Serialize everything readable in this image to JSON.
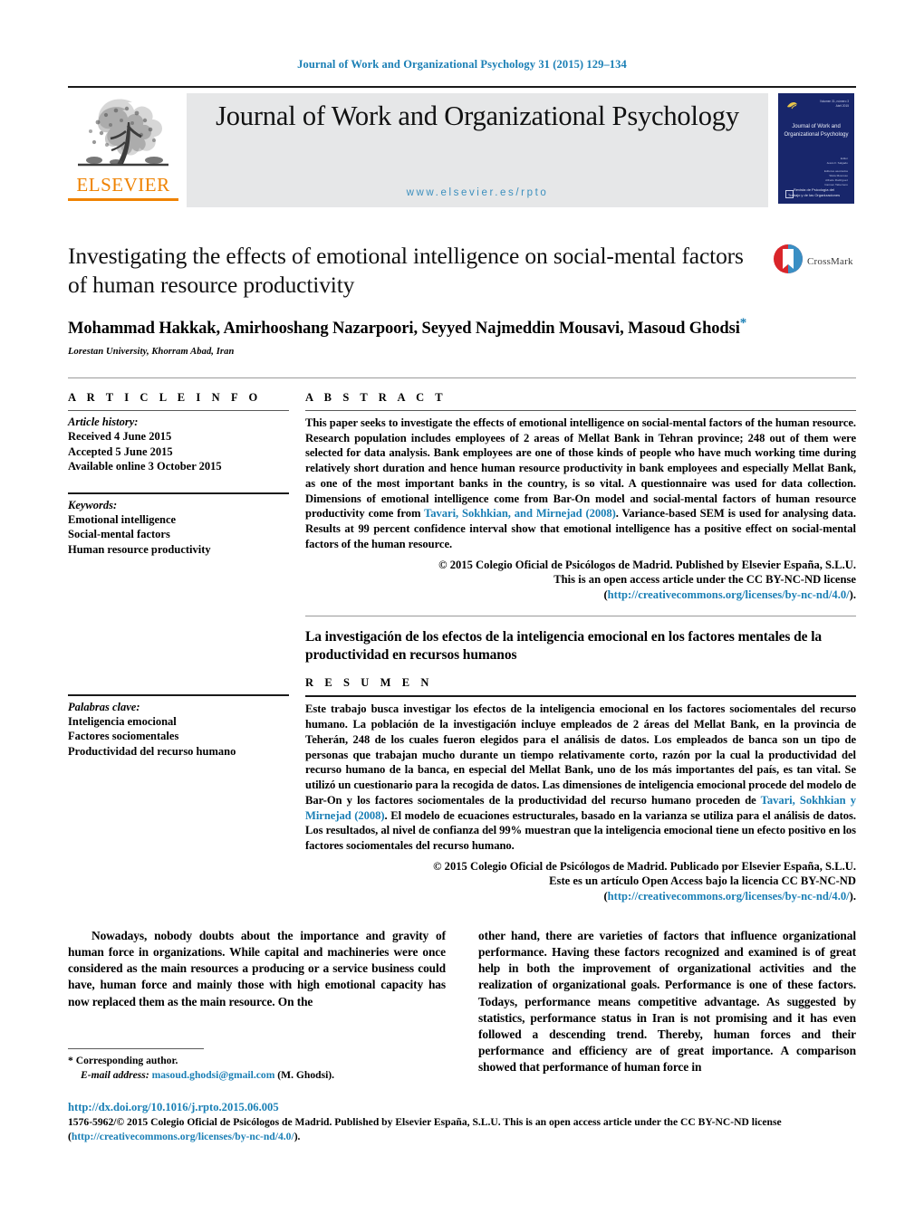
{
  "running_head": "Journal of Work and Organizational Psychology 31 (2015) 129–134",
  "masthead": {
    "publisher": "ELSEVIER",
    "publisher_logo_icon": "elsevier-tree-icon",
    "journal_title": "Journal of Work and Organizational Psychology",
    "journal_url": "www.elsevier.es/rpto",
    "cover": {
      "top_right": "Volumen 31, número 3\nAbril 2015",
      "title": "Journal of Work and\nOrganizational Psychology",
      "editors": "Editor\nJesús F. Salgado\n\nEditores asociados\nSilvia Moscoso\nAlfredo Rodríguez\nCarmen Tabernero",
      "footer": "Revista de Psicología del\nTrabajo y de las Organizaciones",
      "logo_icon": "colegio-logo-icon",
      "mark_icon": "elsevier-mark-icon"
    }
  },
  "article": {
    "title": "Investigating the effects of emotional intelligence on social-mental factors of human resource productivity",
    "authors": "Mohammad Hakkak,  Amirhooshang Nazarpoori,  Seyyed Najmeddin Mousavi, Masoud Ghodsi",
    "author_star": "*",
    "affiliation": "Lorestan University, Khorram Abad, Iran",
    "crossmark_label": "CrossMark",
    "crossmark_icon": "crossmark-icon"
  },
  "article_info": {
    "heading": "A R T I C L E   I N F O",
    "history_label": "Article history:",
    "history": [
      "Received 4 June 2015",
      "Accepted 5 June 2015",
      "Available online 3 October 2015"
    ],
    "keywords_label": "Keywords:",
    "keywords": [
      "Emotional intelligence",
      "Social-mental factors",
      "Human resource productivity"
    ],
    "palabras_label": "Palabras clave:",
    "palabras": [
      "Inteligencia emocional",
      "Factores sociomentales",
      "Productividad del recurso humano"
    ]
  },
  "abstract": {
    "heading": "A B S T R A C T",
    "p1": "This paper seeks to investigate the effects of emotional intelligence on social-mental factors of the human resource. Research population includes employees of 2 areas of Mellat Bank in Tehran province; 248 out of them were selected for data analysis. Bank employees are one of those kinds of people who have much working time during relatively short duration and hence human resource productivity in bank employees and especially Mellat Bank, as one of the most important banks in the country, is so vital. A questionnaire was used for data collection. Dimensions of emotional intelligence come from Bar-On model and social-mental factors of human resource productivity come from ",
    "citation": "Tavari, Sokhkian, and Mirnejad (2008)",
    "p2": ". Variance-based SEM is used for analysing data. Results at 99 percent confidence interval show that emotional intelligence has a positive effect on social-mental factors of the human resource.",
    "copyright_line1": "© 2015 Colegio Oficial de Psicólogos de Madrid. Published by Elsevier España, S.L.U.",
    "copyright_line2": "This is an open access article under the CC BY-NC-ND license",
    "license_open": "(",
    "license_url": "http://creativecommons.org/licenses/by-nc-nd/4.0/",
    "license_close": ")."
  },
  "resumen": {
    "title": "La investigación de los efectos de la inteligencia emocional en los factores mentales de la productividad en recursos humanos",
    "heading": "R E S U M E N",
    "p1": "Este trabajo busca investigar los efectos de la inteligencia emocional en los factores sociomentales del recurso humano. La población de la investigación incluye empleados de 2 áreas del Mellat Bank, en la provincia de Teherán, 248 de los cuales fueron elegidos para el análisis de datos. Los empleados de banca son un tipo de personas que trabajan mucho durante un tiempo relativamente corto, razón por la cual la productividad del recurso humano de la banca, en especial del Mellat Bank, uno de los más importantes del país, es tan vital. Se utilizó un cuestionario para la recogida de datos. Las dimensiones de inteligencia emocional procede del modelo de Bar-On y los factores sociomentales de la productividad del recurso humano proceden de ",
    "citation": "Tavari, Sokhkian y Mirnejad (2008)",
    "p2": ". El modelo de ecuaciones estructurales, basado en la varianza se utiliza para el análisis de datos. Los resultados, al nivel de confianza del 99% muestran que la inteligencia emocional tiene un efecto positivo en los factores sociomentales del recurso humano.",
    "copyright_line1": "© 2015 Colegio Oficial de Psicólogos de Madrid. Publicado por Elsevier España, S.L.U.",
    "copyright_line2": "Este es un artículo Open Access bajo la licencia CC BY-NC-ND",
    "license_open": "(",
    "license_url": "http://creativecommons.org/licenses/by-nc-nd/4.0/",
    "license_close": ")."
  },
  "body": {
    "left_column": "Nowadays, nobody doubts about the importance and gravity of human force in organizations. While capital and machineries were once considered as the main resources a producing or a service business could have, human force and mainly those with high emotional capacity has now replaced them as the main resource. On the",
    "right_column": "other hand, there are varieties of factors that influence organizational performance. Having these factors recognized and examined is of great help in both the improvement of organizational activities and the realization of organizational goals. Performance is one of these factors. Todays, performance means competitive advantage. As suggested by statistics, performance status in Iran is not promising and it has even followed a descending trend. Thereby, human forces and their performance and efficiency are of great importance. A comparison showed that performance of human force in"
  },
  "footnote": {
    "star": "*",
    "corresponding": "Corresponding author.",
    "email_label": "E-mail address:",
    "email": "masoud.ghodsi@gmail.com",
    "email_owner": "(M. Ghodsi)."
  },
  "bottom": {
    "doi": "http://dx.doi.org/10.1016/j.rpto.2015.06.005",
    "issn_copyright": "1576-5962/© 2015 Colegio Oficial de Psicólogos de Madrid. Published by Elsevier España, S.L.U. This is an open access article under the CC BY-NC-ND license",
    "license_open": "(",
    "license_url": "http://creativecommons.org/licenses/by-nc-nd/4.0/",
    "license_close": ")."
  },
  "colors": {
    "link": "#1a7fb5",
    "elsevier_orange": "#ef8200",
    "band_gray": "#e6e7e8",
    "cover_navy": "#18266b"
  }
}
